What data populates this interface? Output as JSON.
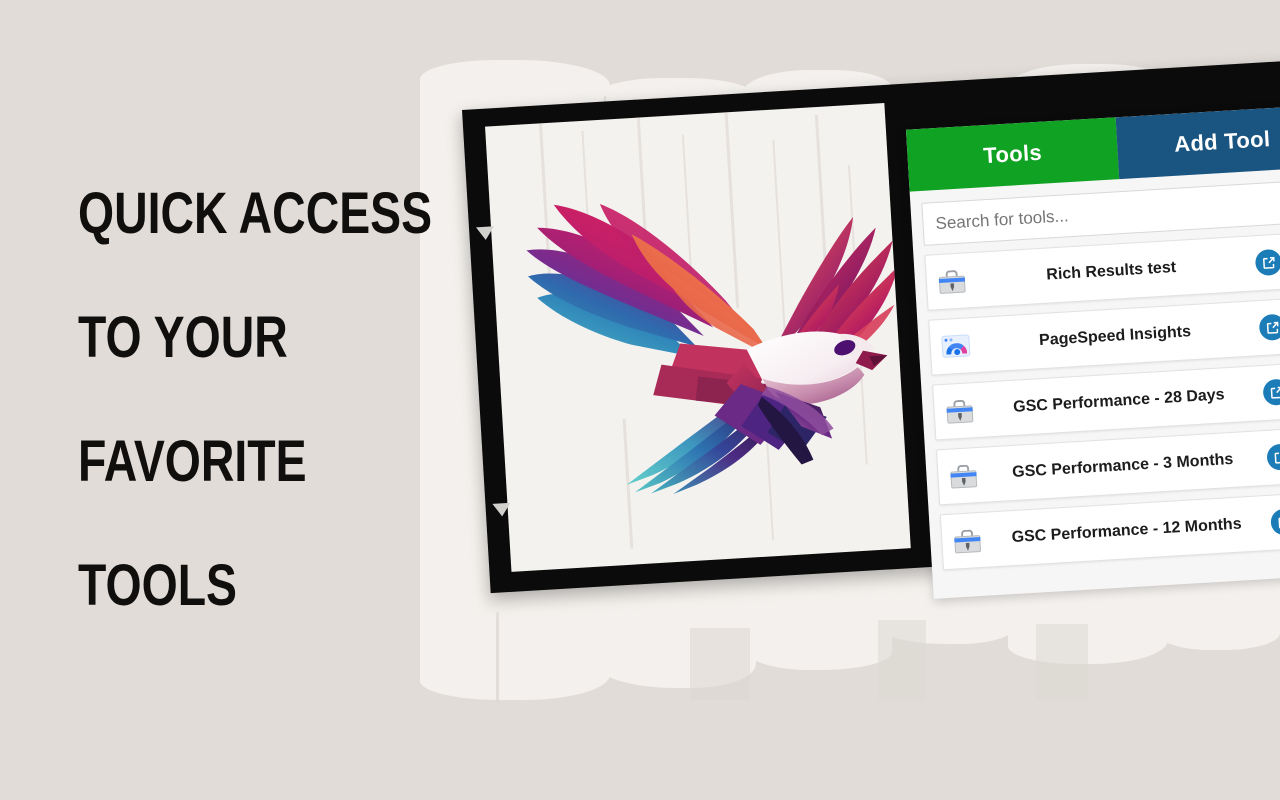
{
  "background": {
    "color": "#E1DCD7",
    "brush_color": "#F3F0ED"
  },
  "headline": {
    "lines": [
      "Quick Access",
      "To Your",
      "Favorite",
      "Tools"
    ],
    "color": "#100F0E"
  },
  "artwork": {
    "name": "eagle-logo",
    "description": "geometric polygonal flying eagle",
    "frame_color": "#0B0B0B",
    "plate_color": "#F4F2EF",
    "handle_top": "triangle-handle-top",
    "handle_bottom": "triangle-handle-bottom"
  },
  "panel": {
    "tabs": [
      {
        "label": "Tools",
        "color": "#0FA223",
        "active": true
      },
      {
        "label": "Add Tool",
        "color": "#1A5480",
        "active": false
      }
    ],
    "search": {
      "placeholder": "Search for tools...",
      "value": ""
    },
    "actions": {
      "edit_label": "edit-icon",
      "delete_label": "trash-icon",
      "edit_color": "#1C7CB8",
      "delete_color": "#E8402A"
    },
    "tools": [
      {
        "name": "Rich Results test",
        "icon": "toolbox-icon"
      },
      {
        "name": "PageSpeed Insights",
        "icon": "pagespeed-icon"
      },
      {
        "name": "GSC Performance - 28 Days",
        "icon": "toolbox-icon"
      },
      {
        "name": "GSC Performance - 3 Months",
        "icon": "toolbox-icon"
      },
      {
        "name": "GSC Performance - 12 Months",
        "icon": "toolbox-icon"
      }
    ]
  }
}
